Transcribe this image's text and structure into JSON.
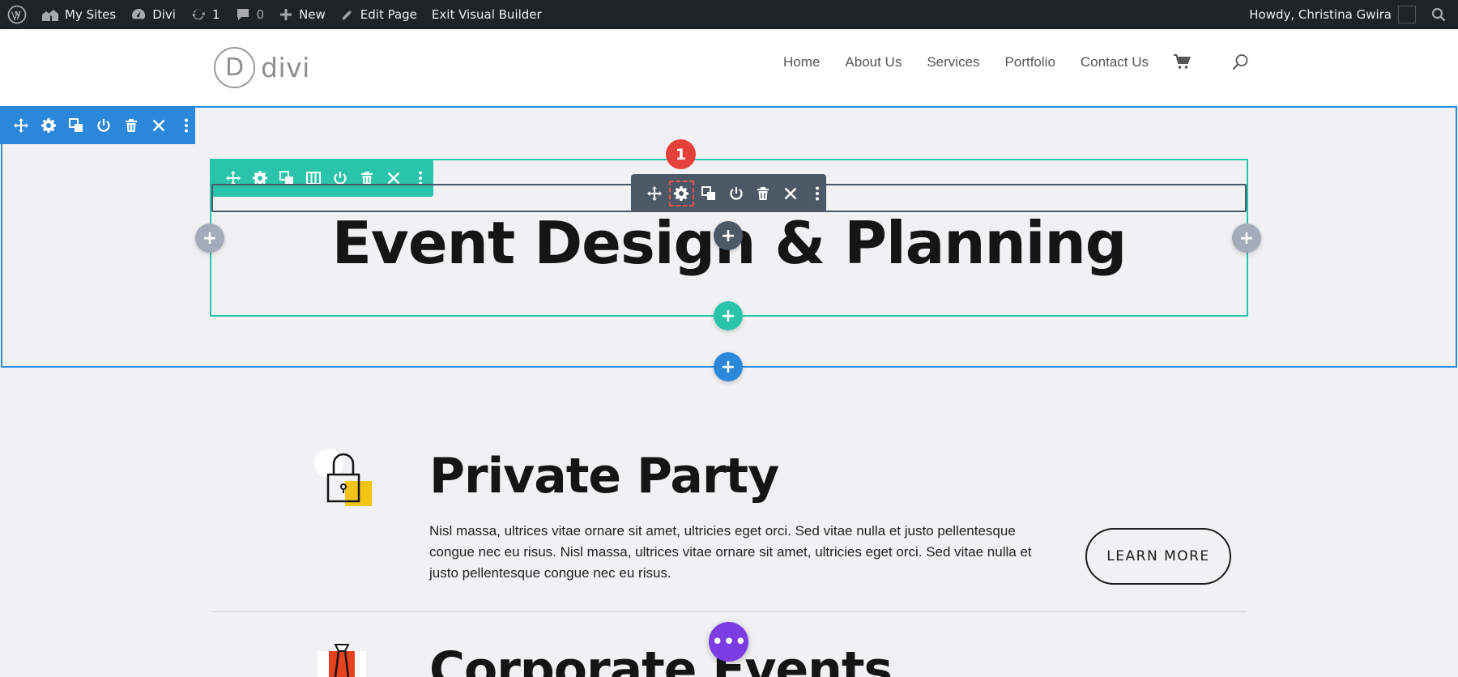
{
  "admin_bar": {
    "my_sites": "My Sites",
    "divi": "Divi",
    "updates_count": "1",
    "comments_count": "0",
    "new": "New",
    "edit_page": "Edit Page",
    "exit_builder": "Exit Visual Builder",
    "greeting": "Howdy, Christina Gwira"
  },
  "site": {
    "logo_letter": "D",
    "logo_text": "divi",
    "nav": [
      "Home",
      "About Us",
      "Services",
      "Portfolio",
      "Contact Us"
    ]
  },
  "builder": {
    "callout_number": "1",
    "add_symbol": "+",
    "more_symbol": "•••"
  },
  "hero": {
    "title": "Event Design & Planning"
  },
  "services": [
    {
      "title": "Private Party",
      "description": "Nisl massa, ultrices vitae ornare sit amet, ultricies eget orci. Sed vitae nulla et justo pellentesque congue nec eu risus. Nisl massa, ultrices vitae ornare sit amet, ultricies eget orci. Sed vitae nulla et justo pellentesque congue nec eu risus.",
      "button": "LEARN MORE",
      "icon": "lock-icon"
    },
    {
      "title": "Corporate Events",
      "icon": "tie-icon"
    }
  ],
  "colors": {
    "section": "#2b87da",
    "row": "#29c4a9",
    "module": "#4c5866",
    "callout": "#e5413a",
    "accent_yellow": "#f2c514",
    "page_settings": "#7b3de3"
  }
}
